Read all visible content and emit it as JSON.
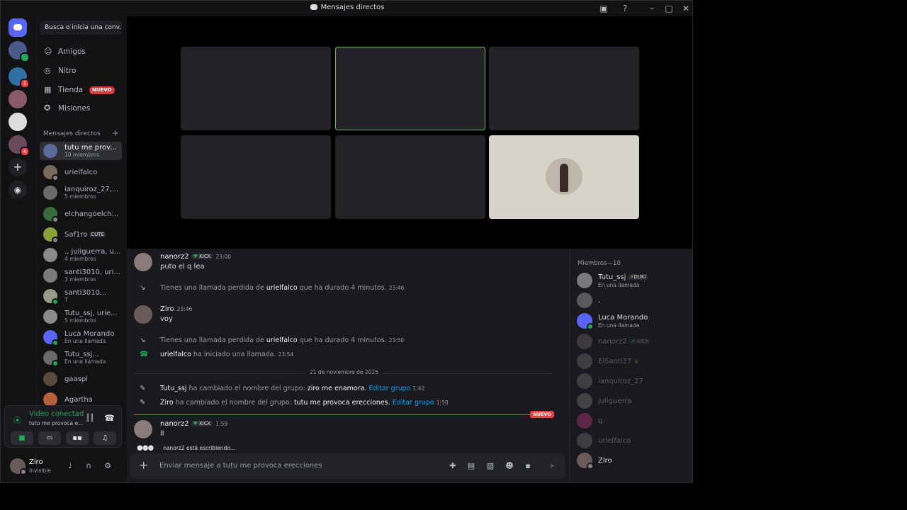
{
  "window": {
    "title": "Mensajes directos"
  },
  "colors": {
    "online": "#23a55a",
    "blurple": "#5865f2",
    "danger": "#f23f43",
    "link": "#00a8fc"
  },
  "servers": {
    "home_icon": "discord-logo-icon",
    "badge_1": "1",
    "badge_2": "4",
    "add_icon": "plus-icon",
    "discover_icon": "compass-icon"
  },
  "sidebar": {
    "search_placeholder": "Busca o inicia una conv...",
    "nav": [
      {
        "label": "Amigos",
        "icon": "friends-icon"
      },
      {
        "label": "Nitro",
        "icon": "nitro-icon"
      },
      {
        "label": "Tienda",
        "icon": "shop-icon",
        "badge": "NUEVO"
      },
      {
        "label": "Misiones",
        "icon": "quests-icon"
      }
    ],
    "dm_header": "Mensajes directos",
    "dms": [
      {
        "name": "tutu me prov...",
        "sub": "10 miembros"
      },
      {
        "name": "urielfalco",
        "sub": ""
      },
      {
        "name": "ianquiroz_27,...",
        "sub": "5 miembros"
      },
      {
        "name": "elchangoelch...",
        "sub": ""
      },
      {
        "name": "Saf1ro",
        "tag": "CUTE",
        "sub": ""
      },
      {
        "name": "., juliguerra, u...",
        "sub": "4 miembros"
      },
      {
        "name": "santi3010, uri...",
        "sub": "3 miembros"
      },
      {
        "name": "santi3010...",
        "sub": "T"
      },
      {
        "name": "Tutu_ssj, urie...",
        "sub": "5 miembros"
      },
      {
        "name": "Luca Morando",
        "sub": "En una llamada"
      },
      {
        "name": "Tutu_ssj...",
        "sub": "En una llamada"
      },
      {
        "name": "gaaspi",
        "sub": ""
      },
      {
        "name": "Agartha",
        "sub": ""
      }
    ],
    "voice": {
      "status": "Video conectad",
      "channel": "tutu me provoca e..."
    },
    "user": {
      "name": "Ziro",
      "status": "Invisible"
    }
  },
  "chat": {
    "messages": [
      {
        "author": "nanorz2",
        "tag": "KICK",
        "time": "23:00",
        "text": "puto el q lea"
      },
      {
        "author": "Ziro",
        "time": "23:46",
        "text": "voy"
      },
      {
        "author": "nanorz2",
        "tag": "KICK",
        "time": "1:59",
        "text": "ll"
      }
    ],
    "system": [
      {
        "pre": "Tienes una llamada perdida de ",
        "who": "urielfalco",
        "post": " que ha durado 4 minutos.",
        "time": "23:46"
      },
      {
        "pre": "Tienes una llamada perdida de ",
        "who": "urielfalco",
        "post": " que ha durado 4 minutos.",
        "time": "23:50"
      },
      {
        "who": "urielfalco",
        "post": " ha iniciado una llamada.",
        "time": "23:54"
      },
      {
        "who": "Tutu_ssj",
        "mid": " ha cambiado el nombre del grupo: ",
        "value": "ziro me enamora.",
        "link": "Editar grupo",
        "time": "1:42"
      },
      {
        "who": "Ziro",
        "mid": " ha cambiado el nombre del grupo: ",
        "value": "tutu me provoca erecciones.",
        "link": "Editar grupo",
        "time": "1:50"
      }
    ],
    "date_divider": "21 de noviembre de 2025",
    "new_label": "NUEVO",
    "typing": "nanorz2 está escribiendo...",
    "composer_placeholder": "Enviar mensaje a tutu me provoca erecciones"
  },
  "members": {
    "header": "Miembros—10",
    "list": [
      {
        "name": "Tutu_ssj",
        "tag": "DUKI",
        "sub": "En una llamada"
      },
      {
        "name": ".",
        "sub": ""
      },
      {
        "name": "Luca Morando",
        "sub": "En una llamada"
      },
      {
        "name": "nanorz2",
        "tag": "KICK",
        "sub": ""
      },
      {
        "name": "ElSanti27",
        "sub": ""
      },
      {
        "name": "ianquiroz_27",
        "sub": ""
      },
      {
        "name": "juliguerra",
        "sub": ""
      },
      {
        "name": "q.",
        "sub": ""
      },
      {
        "name": "urielfalco",
        "sub": ""
      },
      {
        "name": "Ziro",
        "sub": ""
      }
    ]
  }
}
